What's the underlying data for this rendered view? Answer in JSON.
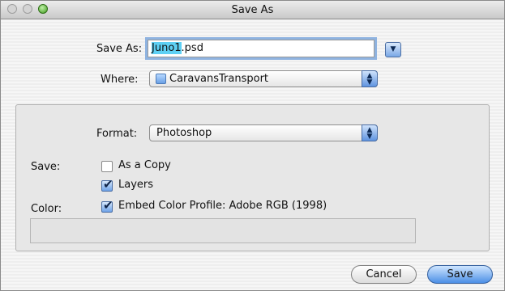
{
  "window": {
    "title": "Save As"
  },
  "save_as": {
    "label": "Save As:",
    "filename_selected": "Juno1",
    "filename_ext": ".psd",
    "expand_glyph": "▼"
  },
  "where": {
    "label": "Where:",
    "value": "CaravansTransport",
    "icon": "folder-icon"
  },
  "format": {
    "label": "Format:",
    "value": "Photoshop"
  },
  "save_options": {
    "label": "Save:",
    "as_copy": {
      "label": "As a Copy",
      "checked": false
    },
    "layers": {
      "label": "Layers",
      "checked": true
    }
  },
  "color": {
    "label": "Color:",
    "embed_profile": {
      "label": "Embed Color Profile:  Adobe RGB (1998)",
      "checked": true
    }
  },
  "buttons": {
    "cancel": "Cancel",
    "save": "Save"
  },
  "colors": {
    "accent": "#4c8fe6",
    "selection": "#5ed0f4"
  }
}
